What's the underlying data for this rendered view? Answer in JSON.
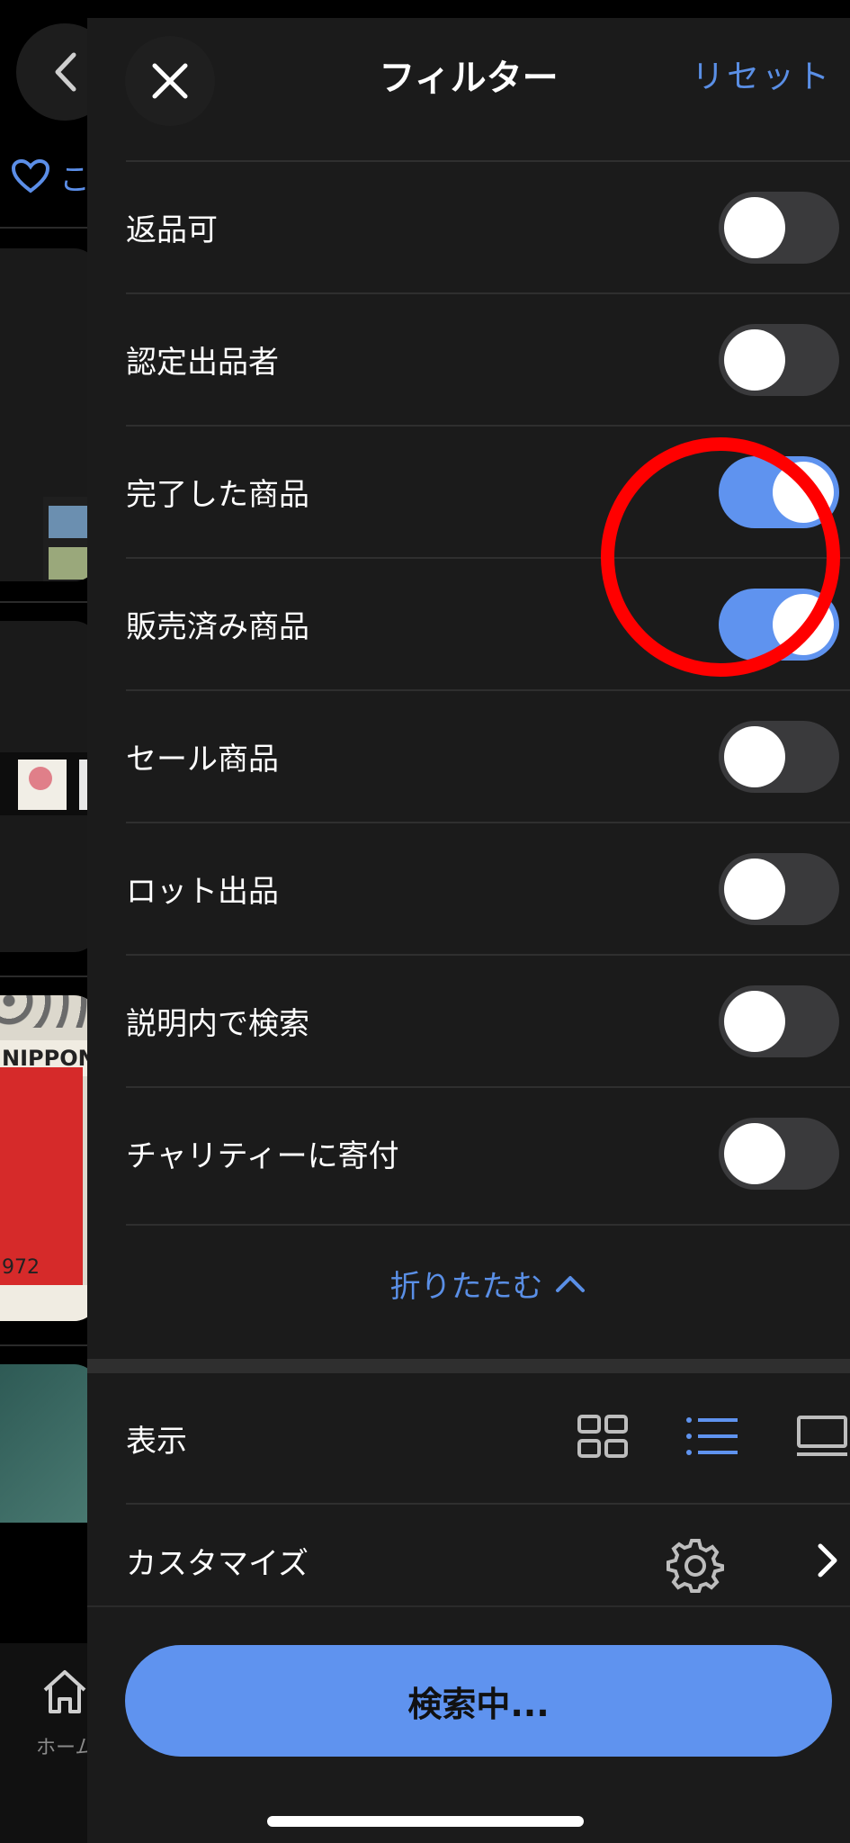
{
  "background": {
    "heart_label": "こ",
    "stamp_text": "NIPPON",
    "stamp_year": "972",
    "tab_home_label": "ホーム"
  },
  "header": {
    "title": "フィルター",
    "reset_label": "リセット",
    "close_icon": "close-icon"
  },
  "filters": [
    {
      "label": "返品可",
      "on": false
    },
    {
      "label": "認定出品者",
      "on": false
    },
    {
      "label": "完了した商品",
      "on": true
    },
    {
      "label": "販売済み商品",
      "on": true
    },
    {
      "label": "セール商品",
      "on": false
    },
    {
      "label": "ロット出品",
      "on": false
    },
    {
      "label": "説明内で検索",
      "on": false
    },
    {
      "label": "チャリティーに寄付",
      "on": false
    }
  ],
  "collapse_label": "折りたたむ",
  "display": {
    "label": "表示",
    "options": [
      "grid-icon",
      "list-icon",
      "gallery-icon"
    ],
    "selected": "list-icon"
  },
  "customize": {
    "label": "カスタマイズ"
  },
  "search_button_label": "検索中...",
  "colors": {
    "accent": "#5f93ef",
    "annotation": "#ff0000"
  }
}
